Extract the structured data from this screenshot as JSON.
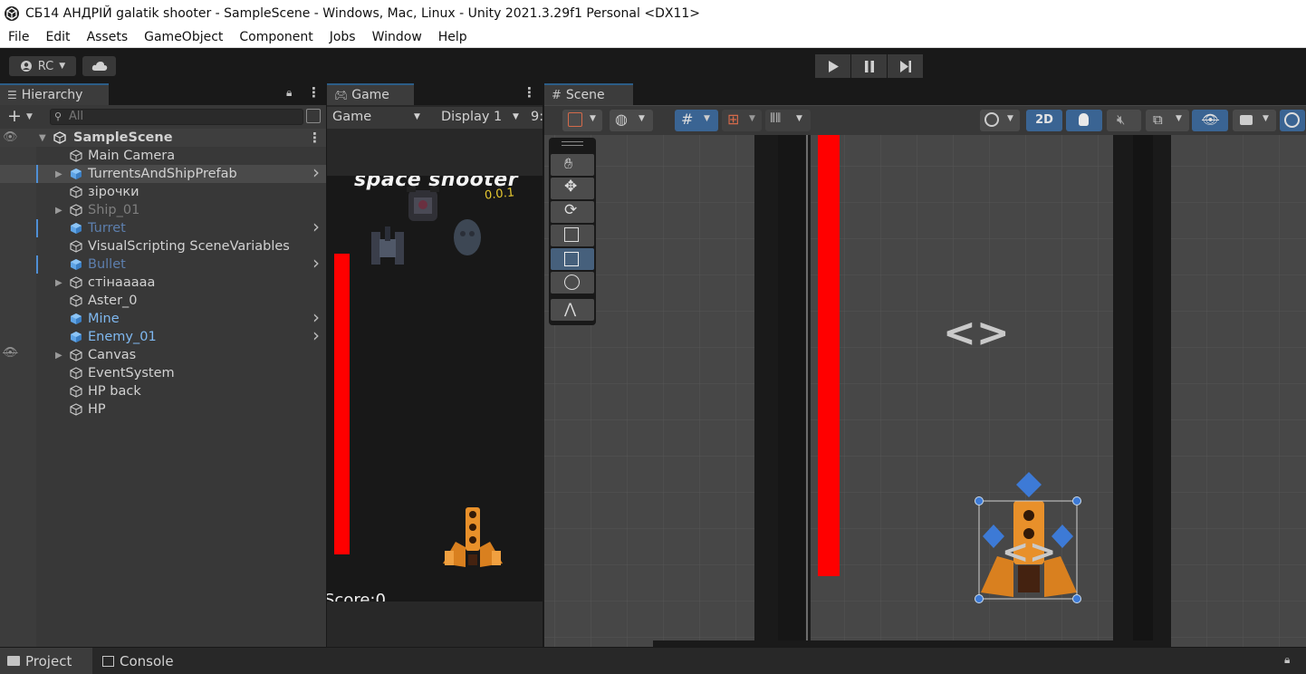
{
  "window": {
    "title": "СБ14 АНДРІЙ galatik shooter - SampleScene - Windows, Mac, Linux - Unity 2021.3.29f1 Personal <DX11>"
  },
  "menu": [
    "File",
    "Edit",
    "Assets",
    "GameObject",
    "Component",
    "Jobs",
    "Window",
    "Help"
  ],
  "toolbar": {
    "account": "RC"
  },
  "hierarchy": {
    "tab": "Hierarchy",
    "add": "+",
    "search_placeholder": "All",
    "scene": "SampleScene",
    "items": [
      {
        "label": "Main Camera",
        "type": "object",
        "color": "#d2d2d2",
        "expand": false,
        "chevron": false,
        "selected": false
      },
      {
        "label": "TurrentsAndShipPrefab",
        "type": "prefab",
        "color": "#d2d2d2",
        "expand": true,
        "chevron": true,
        "selected": true
      },
      {
        "label": "зірочки",
        "type": "object",
        "color": "#d2d2d2",
        "expand": false,
        "chevron": false,
        "selected": false
      },
      {
        "label": "Ship_01",
        "type": "object",
        "color": "#7e7e7e",
        "expand": true,
        "chevron": false,
        "selected": false
      },
      {
        "label": "Turret",
        "type": "prefab",
        "color": "#5d7fae",
        "expand": false,
        "chevron": true,
        "selected": false
      },
      {
        "label": "VisualScripting SceneVariables",
        "type": "object",
        "color": "#d2d2d2",
        "expand": false,
        "chevron": false,
        "selected": false
      },
      {
        "label": "Bullet",
        "type": "prefab",
        "color": "#5d7fae",
        "expand": false,
        "chevron": true,
        "selected": false
      },
      {
        "label": "стінааааа",
        "type": "object",
        "color": "#d2d2d2",
        "expand": true,
        "chevron": false,
        "selected": false
      },
      {
        "label": "Aster_0",
        "type": "object",
        "color": "#d2d2d2",
        "expand": false,
        "chevron": false,
        "selected": false
      },
      {
        "label": "Mine",
        "type": "prefab",
        "color": "#7fb8f0",
        "expand": false,
        "chevron": true,
        "selected": false
      },
      {
        "label": "Enemy_01",
        "type": "prefab",
        "color": "#7fb8f0",
        "expand": false,
        "chevron": true,
        "selected": false
      },
      {
        "label": "Canvas",
        "type": "object",
        "color": "#d2d2d2",
        "expand": true,
        "chevron": false,
        "selected": false
      },
      {
        "label": "EventSystem",
        "type": "object",
        "color": "#d2d2d2",
        "expand": false,
        "chevron": false,
        "selected": false
      },
      {
        "label": "HP back",
        "type": "object",
        "color": "#d2d2d2",
        "expand": false,
        "chevron": false,
        "selected": false
      },
      {
        "label": "HP",
        "type": "object",
        "color": "#d2d2d2",
        "expand": false,
        "chevron": false,
        "selected": false
      }
    ]
  },
  "game": {
    "tab": "Game",
    "mode": "Game",
    "display": "Display 1",
    "aspect_partial": "9:",
    "logo_text": "space shooter",
    "version": "0.0.1",
    "score_text": "Score:0",
    "hp_bar_color": "#ff0000"
  },
  "scene": {
    "tab": "Scene",
    "mode_2d": "2D"
  },
  "bottom": {
    "project_tab": "Project",
    "console_tab": "Console"
  },
  "colors": {
    "accent_blue": "#3a6493",
    "selection": "#4a4a4a",
    "prefab_blue": "#7fb8f0",
    "red_bar": "#ff0000"
  }
}
